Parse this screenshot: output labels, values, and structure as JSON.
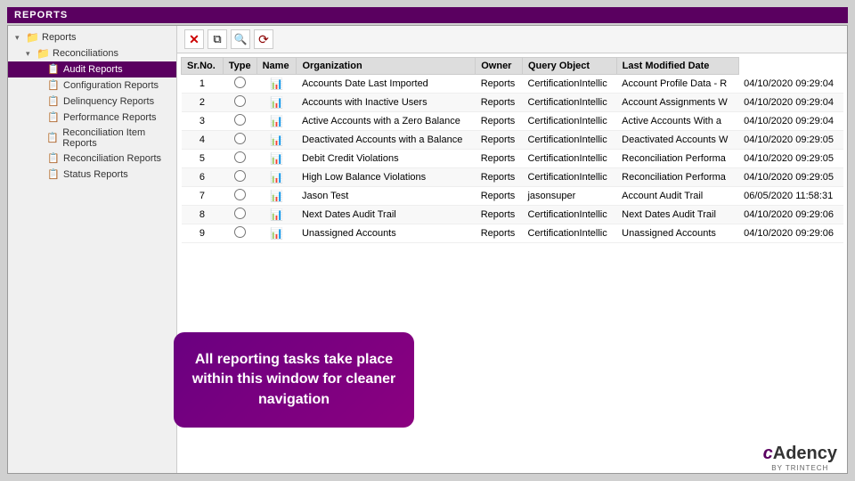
{
  "app": {
    "header": "REPORTS"
  },
  "sidebar": {
    "items": [
      {
        "id": "reports-root",
        "label": "Reports",
        "level": 0,
        "type": "folder",
        "expanded": true
      },
      {
        "id": "reconciliations",
        "label": "Reconciliations",
        "level": 1,
        "type": "folder",
        "expanded": true
      },
      {
        "id": "audit-reports",
        "label": "Audit Reports",
        "level": 2,
        "type": "report",
        "active": true
      },
      {
        "id": "configuration-reports",
        "label": "Configuration Reports",
        "level": 2,
        "type": "report",
        "active": false
      },
      {
        "id": "delinquency-reports",
        "label": "Delinquency Reports",
        "level": 2,
        "type": "report",
        "active": false
      },
      {
        "id": "performance-reports",
        "label": "Performance Reports",
        "level": 2,
        "type": "report",
        "active": false
      },
      {
        "id": "reconciliation-item-reports",
        "label": "Reconciliation Item Reports",
        "level": 2,
        "type": "report",
        "active": false
      },
      {
        "id": "reconciliation-reports",
        "label": "Reconciliation Reports",
        "level": 2,
        "type": "report",
        "active": false
      },
      {
        "id": "status-reports",
        "label": "Status Reports",
        "level": 2,
        "type": "report",
        "active": false
      }
    ]
  },
  "toolbar": {
    "buttons": [
      {
        "id": "delete-btn",
        "icon": "✕",
        "label": "Delete"
      },
      {
        "id": "copy-btn",
        "icon": "⧉",
        "label": "Copy"
      },
      {
        "id": "search-btn",
        "icon": "🔍",
        "label": "Search"
      },
      {
        "id": "refresh-btn",
        "icon": "⟳",
        "label": "Refresh"
      }
    ]
  },
  "table": {
    "columns": [
      "Sr.No.",
      "Type",
      "Name",
      "Organization",
      "Owner",
      "Query Object",
      "Last Modified Date"
    ],
    "rows": [
      {
        "sr": "1",
        "type": "report",
        "name": "Accounts Date Last Imported",
        "organization": "Reports",
        "owner": "CertificationIntellic",
        "query_object": "Account Profile Data - R",
        "modified": "04/10/2020 09:29:04"
      },
      {
        "sr": "2",
        "type": "report",
        "name": "Accounts with Inactive Users",
        "organization": "Reports",
        "owner": "CertificationIntellic",
        "query_object": "Account Assignments W",
        "modified": "04/10/2020 09:29:04"
      },
      {
        "sr": "3",
        "type": "report",
        "name": "Active Accounts with a Zero Balance",
        "organization": "Reports",
        "owner": "CertificationIntellic",
        "query_object": "Active Accounts With a",
        "modified": "04/10/2020 09:29:04"
      },
      {
        "sr": "4",
        "type": "report",
        "name": "Deactivated Accounts with a Balance",
        "organization": "Reports",
        "owner": "CertificationIntellic",
        "query_object": "Deactivated Accounts W",
        "modified": "04/10/2020 09:29:05"
      },
      {
        "sr": "5",
        "type": "report",
        "name": "Debit Credit Violations",
        "organization": "Reports",
        "owner": "CertificationIntellic",
        "query_object": "Reconciliation Performa",
        "modified": "04/10/2020 09:29:05"
      },
      {
        "sr": "6",
        "type": "report",
        "name": "High Low Balance Violations",
        "organization": "Reports",
        "owner": "CertificationIntellic",
        "query_object": "Reconciliation Performa",
        "modified": "04/10/2020 09:29:05"
      },
      {
        "sr": "7",
        "type": "report",
        "name": "Jason Test",
        "organization": "Reports",
        "owner": "jasonsuper",
        "query_object": "Account Audit Trail",
        "modified": "06/05/2020 11:58:31"
      },
      {
        "sr": "8",
        "type": "report",
        "name": "Next Dates Audit Trail",
        "organization": "Reports",
        "owner": "CertificationIntellic",
        "query_object": "Next Dates Audit Trail",
        "modified": "04/10/2020 09:29:06"
      },
      {
        "sr": "9",
        "type": "report",
        "name": "Unassigned Accounts",
        "organization": "Reports",
        "owner": "CertificationIntellic",
        "query_object": "Unassigned Accounts",
        "modified": "04/10/2020 09:29:06"
      }
    ]
  },
  "tooltip": {
    "text": "All reporting tasks take place within this window for cleaner navigation"
  },
  "logo": {
    "name": "cAdency",
    "sub": "BY TRINTECH"
  }
}
